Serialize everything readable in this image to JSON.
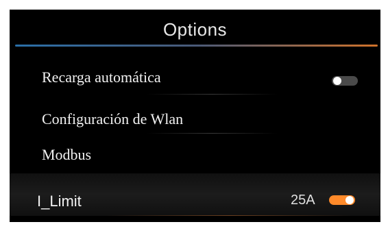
{
  "header": {
    "title": "Options"
  },
  "colors": {
    "header_line_left": "#2a6fa8",
    "header_line_right": "#d0722a",
    "toggle_on": "#ff8a2a",
    "toggle_off": "#4a4a4a"
  },
  "menu": {
    "items": [
      {
        "label": "Recarga automática",
        "toggle": "off"
      },
      {
        "label": "Configuración de Wlan"
      },
      {
        "label": "Modbus"
      }
    ],
    "selected": {
      "label": "I_Limit",
      "value": "25A",
      "toggle": "on"
    }
  }
}
